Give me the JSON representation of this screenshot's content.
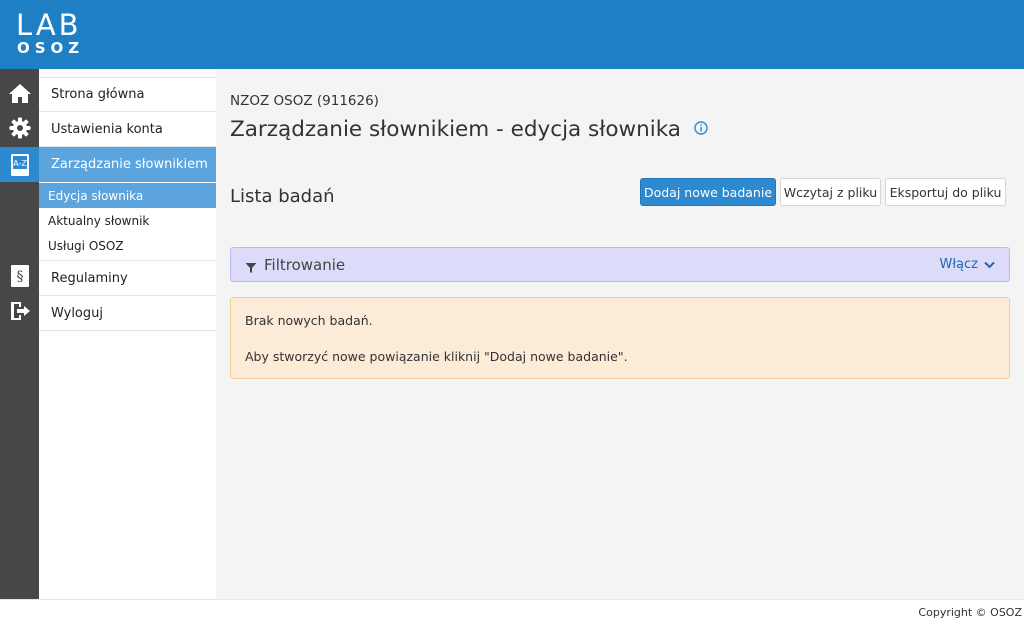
{
  "app": {
    "logo_top": "LAB",
    "logo_bottom": "OSOZ"
  },
  "icon_rail": [
    {
      "icon": "home-icon",
      "active": false
    },
    {
      "icon": "gear-icon",
      "active": false
    },
    {
      "icon": "dictionary-az-icon",
      "active": true
    },
    {
      "icon": "paragraph-document-icon",
      "active": false
    },
    {
      "icon": "logout-icon",
      "active": false
    }
  ],
  "sidebar": {
    "items": [
      {
        "label": "Strona główna"
      },
      {
        "label": "Ustawienia konta"
      },
      {
        "label": "Zarządzanie słownikiem"
      }
    ],
    "subitems": [
      {
        "label": "Edycja słownika"
      },
      {
        "label": "Aktualny słownik"
      },
      {
        "label": "Usługi OSOZ"
      }
    ],
    "bottom_items": [
      {
        "label": "Regulaminy"
      },
      {
        "label": "Wyloguj"
      }
    ]
  },
  "main": {
    "org": "NZOZ OSOZ (911626)",
    "title": "Zarządzanie słownikiem - edycja słownika",
    "list_title": "Lista badań",
    "buttons": {
      "add": "Dodaj nowe badanie",
      "load": "Wczytaj z pliku",
      "export": "Eksportuj do pliku"
    },
    "filter": {
      "label": "Filtrowanie",
      "toggle": "Włącz"
    },
    "alert": {
      "line1": "Brak nowych badań.",
      "line2": "Aby stworzyć nowe powiązanie kliknij \"Dodaj nowe badanie\"."
    }
  },
  "footer": {
    "copyright": "Copyright © OSOZ"
  },
  "colors": {
    "topbar": "#1f7fc5",
    "rail": "#474747",
    "active": "#5ca4dd",
    "primary": "#2d8ad0",
    "filter_bg": "#dcdcfa",
    "alert_bg": "#fcebd7"
  }
}
